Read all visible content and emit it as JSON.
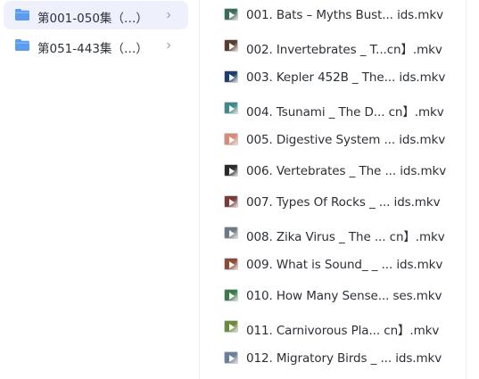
{
  "sidebar": {
    "folders": [
      {
        "label": "第001-050集（…）",
        "selected": true
      },
      {
        "label": "第051-443集（…）",
        "selected": false
      }
    ]
  },
  "colors": {
    "folder": "#5b9cf0",
    "selected_bg": "#eef1fb",
    "text": "#2b2f36"
  },
  "files": [
    {
      "name": "001. Bats – Myths Bust... ids.mkv",
      "thumb_color": "#3a6b5c"
    },
    {
      "name": "002. Invertebrates _ T...cn】.mkv",
      "thumb_color": "#5a3b2e"
    },
    {
      "name": "003. Kepler 452B _ The... ids.mkv",
      "thumb_color": "#1e3d6b"
    },
    {
      "name": "004. Tsunami _ The D... cn】.mkv",
      "thumb_color": "#3c8a8a"
    },
    {
      "name": "005. Digestive System ... ids.mkv",
      "thumb_color": "#d98a78"
    },
    {
      "name": "006. Vertebrates _ The ... ids.mkv",
      "thumb_color": "#2d2a26"
    },
    {
      "name": "007. Types Of Rocks _ ... ids.mkv",
      "thumb_color": "#7a3a3a"
    },
    {
      "name": "008. Zika Virus _ The ... cn】.mkv",
      "thumb_color": "#6d7a86"
    },
    {
      "name": "009. What is Sound_ _ ... ids.mkv",
      "thumb_color": "#8a4a36"
    },
    {
      "name": "010. How Many Sense... ses.mkv",
      "thumb_color": "#3d7a4a"
    },
    {
      "name": "011. Carnivorous Pla... cn】.mkv",
      "thumb_color": "#6b8a3a"
    },
    {
      "name": "012. Migratory Birds _ ... ids.mkv",
      "thumb_color": "#6a7f9a"
    }
  ]
}
